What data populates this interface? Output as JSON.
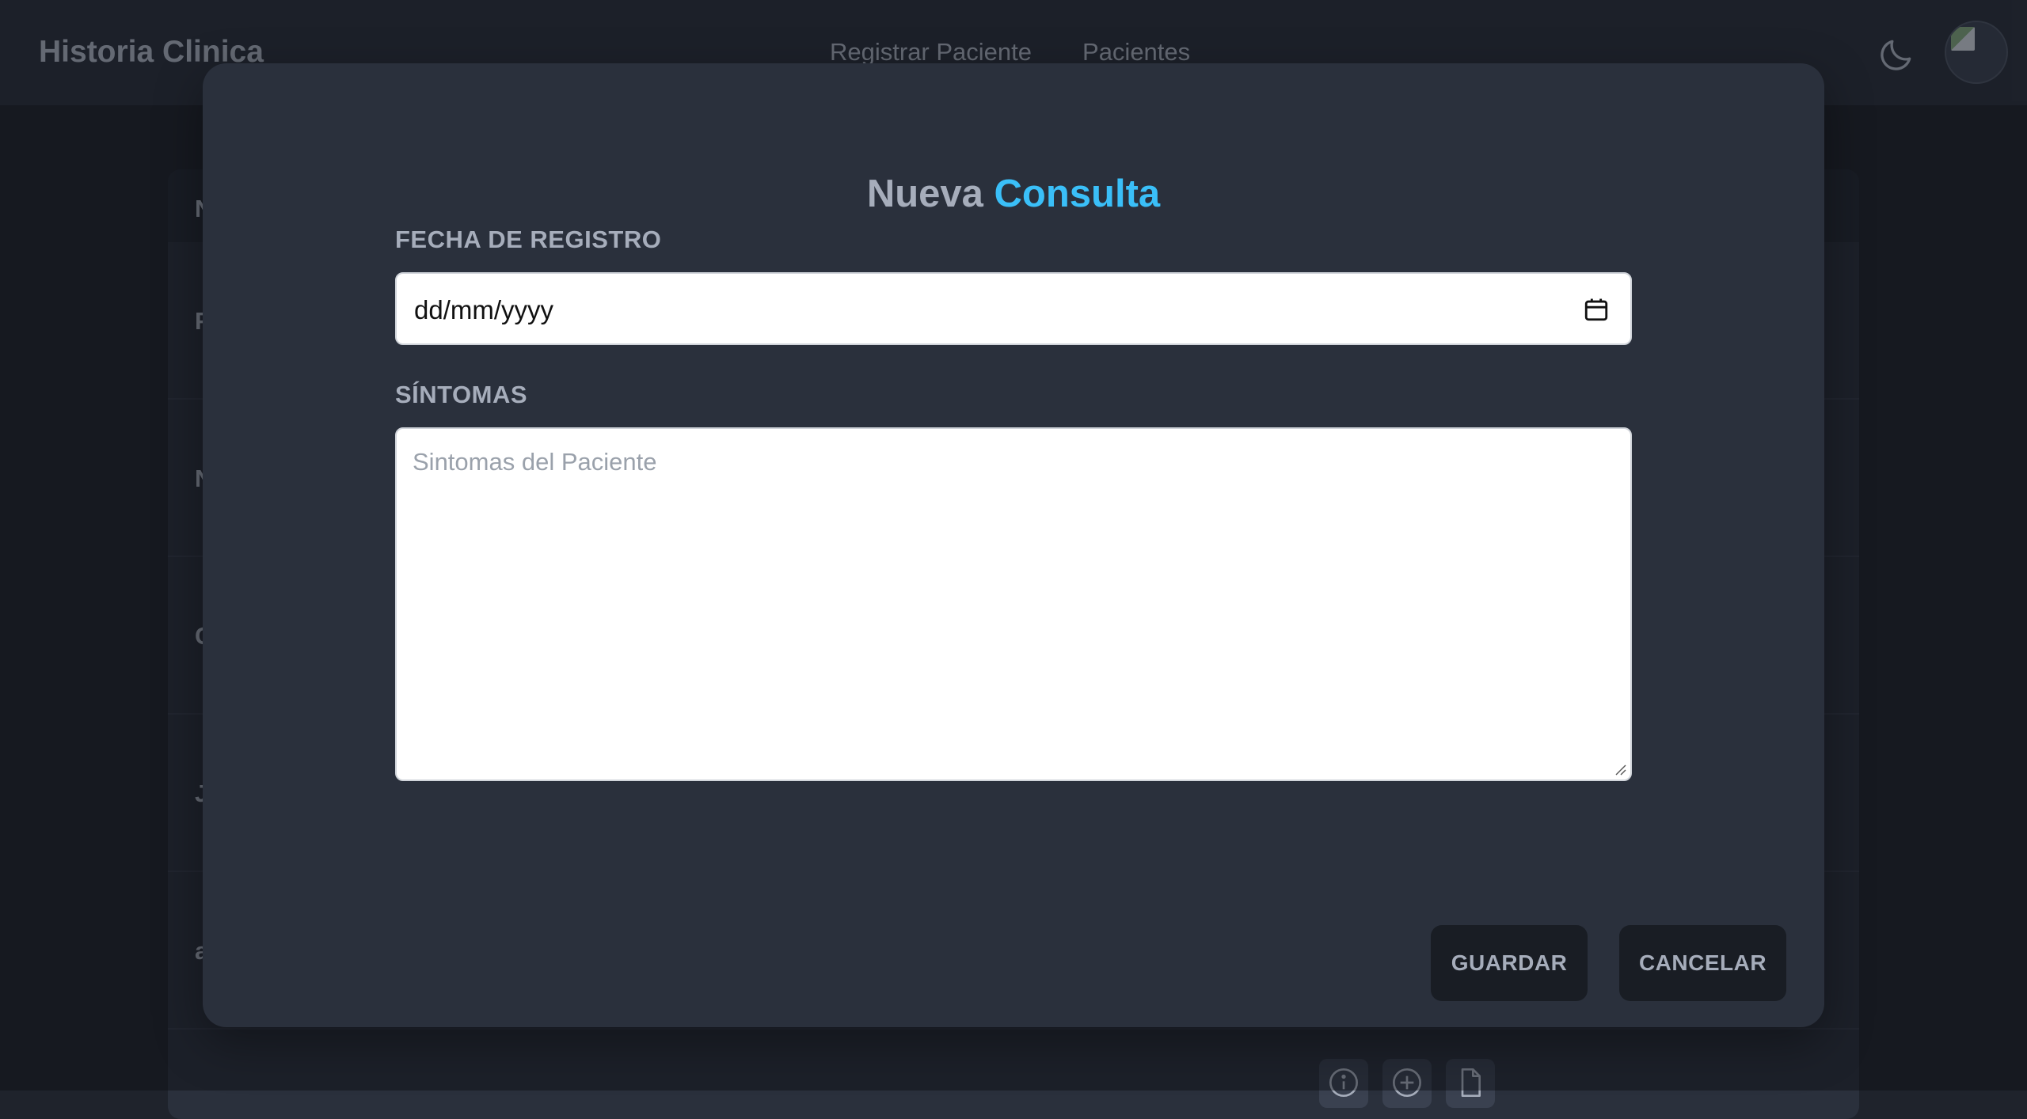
{
  "app": {
    "brand": "Historia Clinica",
    "nav": [
      "Registrar Paciente",
      "Pacientes"
    ]
  },
  "table": {
    "header_initial": "N",
    "row_initials": [
      "F",
      "N",
      "C",
      "J",
      "a"
    ]
  },
  "modal": {
    "title_part1": "Nueva",
    "title_part2": "Consulta",
    "date_label": "FECHA DE REGISTRO",
    "date_value": "dd/mm/yyyy",
    "symptoms_label": "SÍNTOMAS",
    "symptoms_placeholder": "Sintomas del Paciente",
    "save_label": "GUARDAR",
    "cancel_label": "CANCELAR"
  },
  "colors": {
    "accent": "#3abff8",
    "surface": "#2a303c",
    "text": "#a6adbb",
    "button": "#191d24"
  },
  "icons": [
    "moon-icon",
    "calendar-icon",
    "info-icon",
    "plus-circle-icon",
    "document-icon"
  ]
}
